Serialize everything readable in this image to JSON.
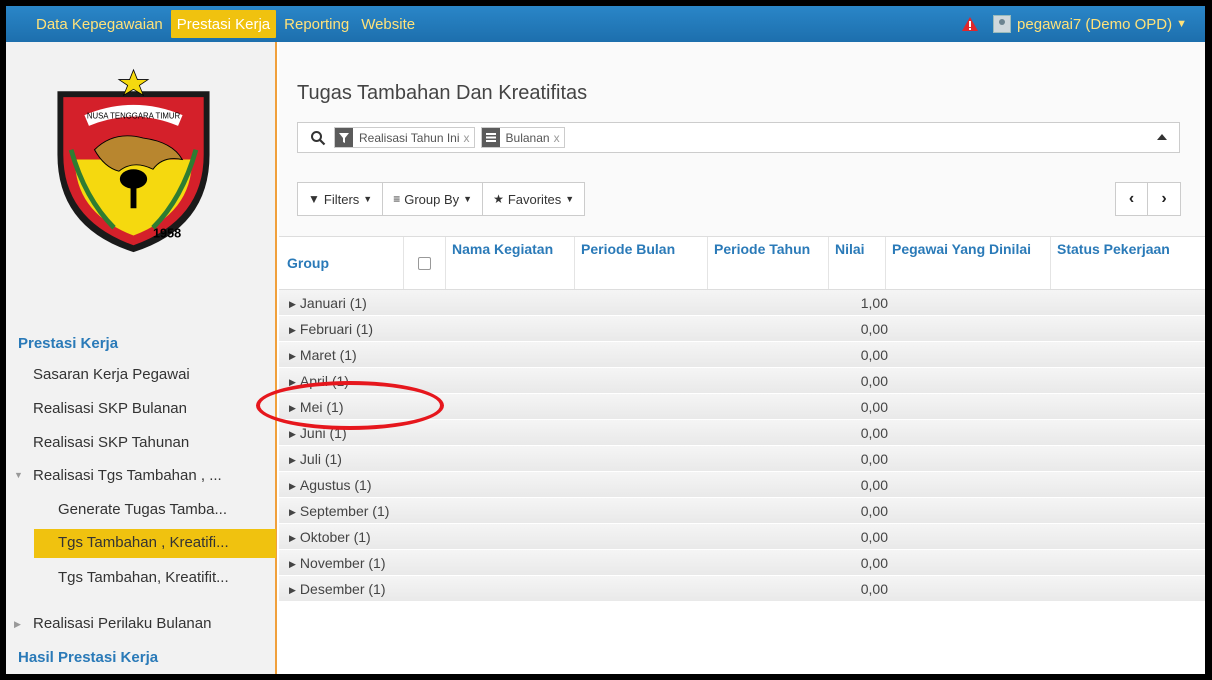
{
  "nav": {
    "items": [
      "Data Kepegawaian",
      "Prestasi Kerja",
      "Reporting",
      "Website"
    ],
    "active_index": 1,
    "user": "pegawai7 (Demo OPD)"
  },
  "sidebar": {
    "logo_text": "NUSA TENGGARA TIMUR",
    "logo_year": "1958",
    "section1": "Prestasi Kerja",
    "items": [
      "Sasaran Kerja Pegawai",
      "Realisasi SKP Bulanan",
      "Realisasi SKP Tahunan",
      "Realisasi Tgs Tambahan , ...",
      "Generate Tugas Tamba...",
      "Tgs Tambahan , Kreatifi...",
      "Tgs Tambahan, Kreatifit...",
      "Realisasi Perilaku Bulanan"
    ],
    "section2": "Hasil Prestasi Kerja"
  },
  "main": {
    "title": "Tugas Tambahan Dan Kreatifitas",
    "facets": [
      "Realisasi Tahun Ini",
      "Bulanan"
    ],
    "facet_remove": "x",
    "buttons": [
      "Filters",
      "Group By",
      "Favorites"
    ],
    "pager_prev": "‹",
    "pager_next": "›"
  },
  "table": {
    "columns": [
      "Group",
      "Nama Kegiatan",
      "Periode Bulan",
      "Periode Tahun",
      "Nilai",
      "Pegawai Yang Dinilai",
      "Status Pekerjaan"
    ],
    "rows": [
      {
        "group": "Januari (1)",
        "nilai": "1,00"
      },
      {
        "group": "Februari (1)",
        "nilai": "0,00"
      },
      {
        "group": "Maret (1)",
        "nilai": "0,00"
      },
      {
        "group": "April (1)",
        "nilai": "0,00"
      },
      {
        "group": "Mei (1)",
        "nilai": "0,00"
      },
      {
        "group": "Juni (1)",
        "nilai": "0,00"
      },
      {
        "group": "Juli (1)",
        "nilai": "0,00"
      },
      {
        "group": "Agustus (1)",
        "nilai": "0,00"
      },
      {
        "group": "September (1)",
        "nilai": "0,00"
      },
      {
        "group": "Oktober (1)",
        "nilai": "0,00"
      },
      {
        "group": "November (1)",
        "nilai": "0,00"
      },
      {
        "group": "Desember (1)",
        "nilai": "0,00"
      }
    ]
  },
  "colors": {
    "topbar": "#1f77b4",
    "accent": "#f0c20f",
    "link": "#2a7ab8",
    "annotation": "#e6171d"
  }
}
